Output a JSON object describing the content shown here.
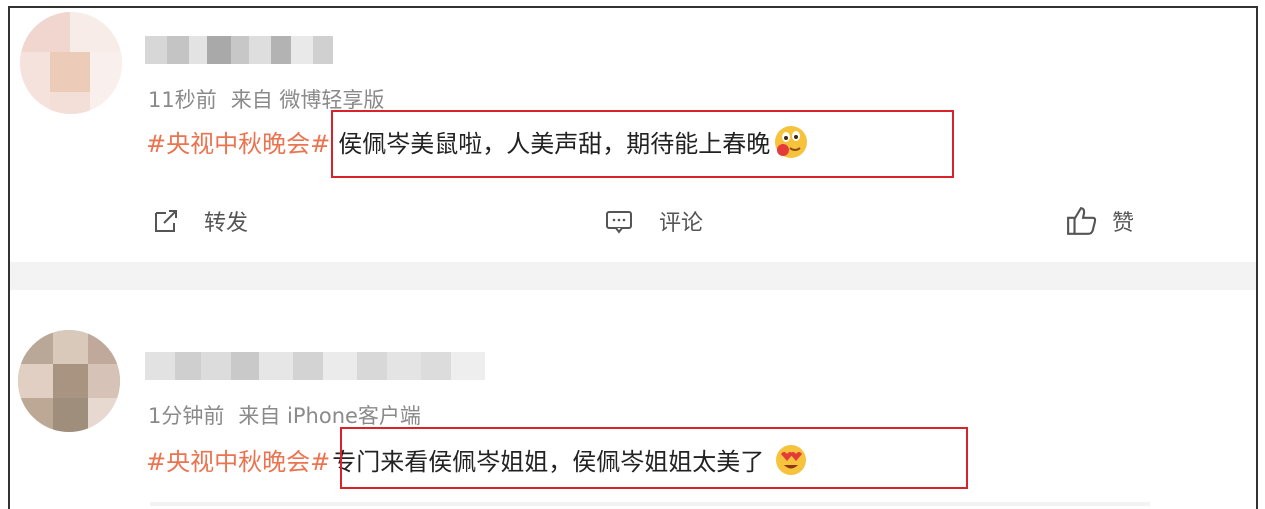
{
  "comments": [
    {
      "time": "11秒前",
      "source": "来自 微博轻享版",
      "hashtag": "#央视中秋晚会#",
      "text": "侯佩岑美鼠啦，人美声甜，期待能上春晚",
      "emoji": "drooling-face-emoji"
    },
    {
      "time": "1分钟前",
      "source": "来自 iPhone客户端",
      "hashtag": "#央视中秋晚会#",
      "text": "专门来看侯佩岑姐姐，侯佩岑姐姐太美了",
      "emoji": "heart-eyes-emoji"
    }
  ],
  "actions": {
    "repost": "转发",
    "comment": "评论",
    "like": "赞"
  },
  "colors": {
    "hashtag": "#eb7350",
    "highlight_box": "#d8232a",
    "meta": "#8a8a8a"
  }
}
